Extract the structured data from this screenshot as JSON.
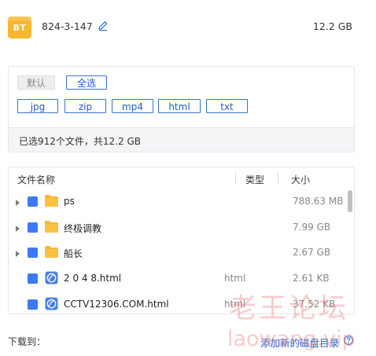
{
  "torrent": {
    "icon_label": "BT",
    "name": "824-3-147",
    "total_size": "12.2 GB"
  },
  "filters": {
    "default_label": "默认",
    "select_all_label": "全选",
    "types": [
      "jpg",
      "zip",
      "mp4",
      "html",
      "txt"
    ]
  },
  "summary": "已选912个文件，共12.2 GB",
  "table": {
    "headers": {
      "name": "文件名称",
      "type": "类型",
      "size": "大小"
    },
    "rows": [
      {
        "kind": "folder",
        "name": "ps",
        "type": "",
        "size": "788.63 MB",
        "expandable": true,
        "checked": true
      },
      {
        "kind": "folder",
        "name": "终极调教",
        "type": "",
        "size": "7.99 GB",
        "expandable": true,
        "checked": true
      },
      {
        "kind": "folder",
        "name": "船长",
        "type": "",
        "size": "2.67 GB",
        "expandable": true,
        "checked": true
      },
      {
        "kind": "html",
        "name": "2 0 4 8.html",
        "type": "html",
        "size": "2.61 KB",
        "expandable": false,
        "checked": true
      },
      {
        "kind": "html",
        "name": "CCTV12306.COM.html",
        "type": "html",
        "size": "37.52 KB",
        "expandable": false,
        "checked": true
      }
    ]
  },
  "footer": {
    "download_to_label": "下载到：",
    "add_dir_label": "添加新的磁盘目录"
  },
  "watermark": {
    "line1": "老王论坛",
    "line2": "laowang.vip"
  },
  "colors": {
    "accent": "#3b7af4",
    "link": "#2b64c7",
    "folder": "#f7b72f",
    "watermark": "#ec5c5c"
  }
}
